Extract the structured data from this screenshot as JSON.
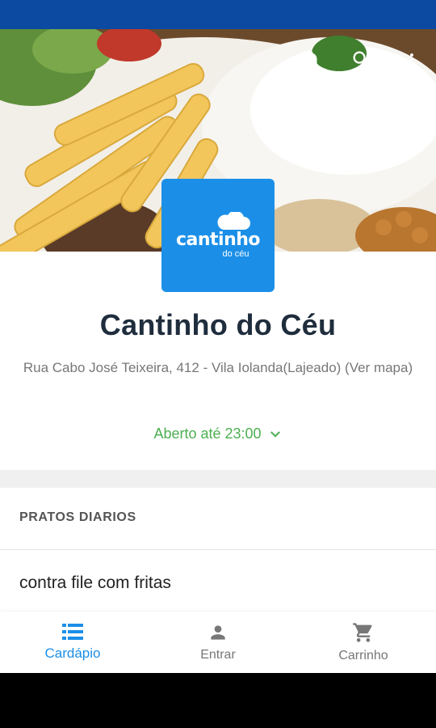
{
  "restaurant": {
    "logo_main": "cantinho",
    "logo_sub": "do céu",
    "name": "Cantinho do Céu",
    "address": "Rua Cabo José Teixeira, 412 - Vila Iolanda(Lajeado) (Ver mapa)",
    "open_status": "Aberto até 23:00"
  },
  "toolbar": {
    "icons": [
      "bell-icon",
      "search-icon",
      "more-vert-icon"
    ]
  },
  "menu": {
    "section_title": "PRATOS DIARIOS",
    "items": [
      {
        "name": "contra file com fritas"
      }
    ]
  },
  "bottom_nav": {
    "items": [
      {
        "label": "Cardápio",
        "icon": "menu-list-icon",
        "active": true
      },
      {
        "label": "Entrar",
        "icon": "person-icon",
        "active": false
      },
      {
        "label": "Carrinho",
        "icon": "cart-icon",
        "active": false
      }
    ]
  },
  "colors": {
    "status_bar": "#0b4aa0",
    "brand_blue": "#1b8fe8",
    "open_green": "#4caf50",
    "title_dark": "#1f2d3d"
  }
}
